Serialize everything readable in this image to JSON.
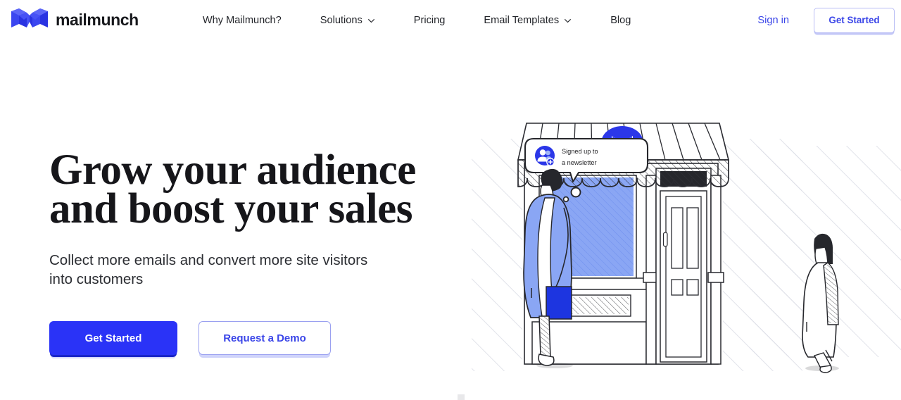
{
  "brand": {
    "name": "mailmunch",
    "logo_icon": "mailmunch-m-logo",
    "logo_color": "#2f3af4"
  },
  "header": {
    "nav": [
      {
        "label": "Why Mailmunch?",
        "has_dropdown": false
      },
      {
        "label": "Solutions",
        "has_dropdown": true
      },
      {
        "label": "Pricing",
        "has_dropdown": false
      },
      {
        "label": "Email Templates",
        "has_dropdown": true
      },
      {
        "label": "Blog",
        "has_dropdown": false
      }
    ],
    "sign_in_label": "Sign in",
    "get_started_label": "Get Started"
  },
  "hero": {
    "title": "Grow your audience\nand boost your sales",
    "subtitle": "Collect more emails and convert more site visitors\ninto customers",
    "primary_cta": "Get Started",
    "secondary_cta": "Request a Demo"
  },
  "illustration": {
    "name": "storefront-shopper-illustration",
    "notification": {
      "line1": "Signed up to",
      "line2": "a newsletter",
      "avatar_icon": "user-plus-avatar-icon"
    },
    "sign_badge_icon": "mailmunch-m-logo-badge"
  },
  "colors": {
    "accent_blue": "#2a33f7",
    "link_blue": "#3b46e8",
    "window_blue": "#7d9bf2",
    "text_dark": "#16161a",
    "hatch_gray": "#d9dbe3"
  }
}
